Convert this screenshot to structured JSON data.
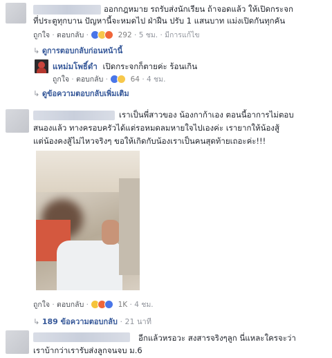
{
  "comment1": {
    "text_line1": "ออกกฎหมาย รถรับส่งนักเรียน ถ้าจอดแล้ว ให้เปิดกระจก",
    "text_line2": "ที่ประตูทุกบาน ปัญหานี้จะหมดไป ฝ่าฝืน ปรับ 1 แสนบาท แม่งเปิดกันทุกคัน",
    "like_label": "ถูกใจ",
    "reply_label": "ตอบกลับ",
    "reaction_count": "292",
    "time": "5 ชม.",
    "edited": "มีการแก้ไข",
    "prev_replies": "ดูการตอบกลับก่อนหน้านี้"
  },
  "reply1": {
    "author": "แหม่มโพธิ์ดำ",
    "text": "เปิดกระจกก็ตายค่ะ ร้อนเกิน",
    "like_label": "ถูกใจ",
    "reply_label": "ตอบกลับ",
    "reaction_count": "64",
    "time": "4 ชม.",
    "more_replies": "ดูข้อความตอบกลับเพิ่มเติม"
  },
  "comment2": {
    "text_line1": "เราเป็นพี่สาวของ น้องกาก้าเอง ตอนนี้อาการไม่ตอบ",
    "text_line2": "สนองแล้ว ทางครอบครัวได้แต่รอหมดลมหายใจไปเองค่ะ เรายากให้น้องสู้",
    "text_line3": "แต่น้องคงสู้ไม่ไหวจริงๆ ขอให้เกิดกับน้องเราเป็นคนสุดท้ายเถอะค่ะ!!!",
    "like_label": "ถูกใจ",
    "reply_label": "ตอบกลับ",
    "reaction_count": "1K",
    "time": "4 ชม.",
    "replies_count": "189 ข้อความตอบกลับ",
    "replies_time": "21 นาที"
  },
  "comment3": {
    "text_line1": "อีกแล้วหรอวะ สงสารจริงๆลูก นี่แหละใครจะว่า",
    "text_line2": "เราบ้ากว่าเรารับส่งลูกจนจบ ม.6"
  },
  "icons": {
    "reply_arrow": "reply-arrow-icon",
    "like_reaction": "like-reaction-icon",
    "haha_reaction": "haha-reaction-icon",
    "angry_reaction": "angry-reaction-icon",
    "sad_reaction": "sad-reaction-icon"
  },
  "colors": {
    "link_blue": "#365899",
    "meta_gray": "#90949c",
    "like_blue": "#4a76e8"
  }
}
